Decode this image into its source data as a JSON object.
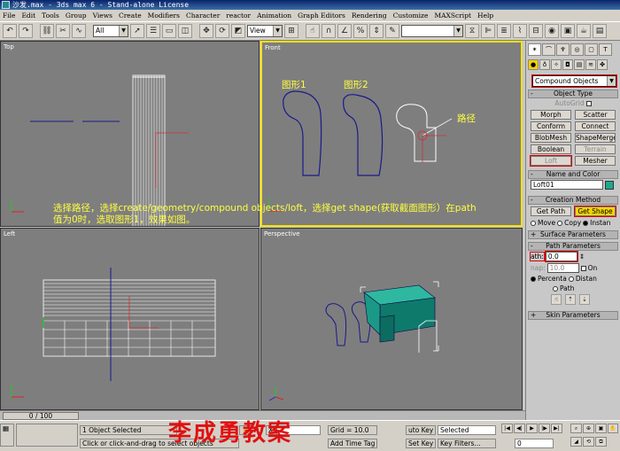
{
  "window": {
    "title": "沙发.max - 3ds max 6 - Stand-alone License"
  },
  "menu": [
    "File",
    "Edit",
    "Tools",
    "Group",
    "Views",
    "Create",
    "Modifiers",
    "Character",
    "reactor",
    "Animation",
    "Graph Editors",
    "Rendering",
    "Customize",
    "MAXScript",
    "Help"
  ],
  "toolbar": {
    "selection_filter": "All",
    "ref_coord": "View",
    "named_selection": ""
  },
  "viewports": {
    "top": "Top",
    "front": "Front",
    "left": "Left",
    "perspective": "Perspective"
  },
  "front_annotations": {
    "shape1": "图形1",
    "shape2": "图形2",
    "path": "路径"
  },
  "instruction": {
    "line1": "选择路径，选择create/geometry/compound objects/loft，选择get shape(获取截面图形）在path",
    "line2": "值为0时，选取图形1，效果如图。"
  },
  "command_panel": {
    "category": "Compound Objects",
    "object_type_title": "Object Type",
    "autogrid": "AutoGrid",
    "buttons": [
      "Morph",
      "Scatter",
      "Conform",
      "Connect",
      "BlobMesh",
      "ShapeMerge",
      "Boolean",
      "Terrain",
      "Loft",
      "Mesher"
    ],
    "name_color_title": "Name and Color",
    "object_name": "Loft01",
    "creation_method_title": "Creation Method",
    "get_path": "Get Path",
    "get_shape": "Get Shape",
    "move": "Move",
    "copy": "Copy",
    "instance": "Instan",
    "surface_params": "Surface Parameters",
    "path_params": "Path Parameters",
    "path_label": "ath:",
    "path_value": "0.0",
    "snap_label": "nap:",
    "snap_value": "10.0",
    "on_label": "On",
    "percentage": "Percenta",
    "distance": "Distan",
    "path_steps": "Path",
    "skin_params": "Skin Parameters",
    "colors": {
      "swatch": "#1ca88c",
      "active_border": "#f5e000"
    }
  },
  "timeline": {
    "frame": "0 / 100"
  },
  "status": {
    "selected": "1 Object Selected",
    "prompt": "Click or click-and-drag to select objects",
    "x_label": "X",
    "grid": "Grid = 10.0",
    "add_time_tag": "Add Time Tag",
    "auto_key": "uto Key",
    "set_key": "Set Key",
    "key_mode": "Selected",
    "key_filters": "Key Filters...",
    "frame_field": "0"
  },
  "watermark": "李成勇教案"
}
